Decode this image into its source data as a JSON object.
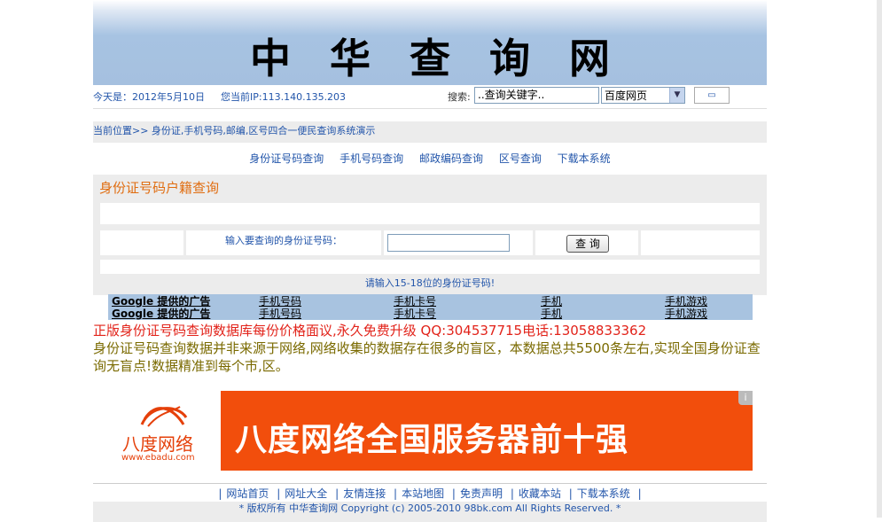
{
  "header": {
    "site_title": "中华查询网"
  },
  "infobar": {
    "date": "今天是：2012年5月10日",
    "ip": "您当前IP:113.140.135.203",
    "search_label": "搜索:",
    "search_placeholder": "..查询关键字..",
    "engine_selected": "百度网页",
    "go_label": "▭"
  },
  "breadcrumb": "当前位置>> 身份证,手机号码,邮编,区号四合一便民查询系统演示",
  "nav": [
    "身份证号码查询",
    "手机号码查询",
    "邮政编码查询",
    "区号查询",
    "下载本系统"
  ],
  "query_panel": {
    "title": "身份证号码户籍查询",
    "input_label": "输入要查询的身份证号码：",
    "button_label": "查 询",
    "hint": "请输入15-18位的身份证号码!"
  },
  "ad_links": [
    {
      "label": "Google 提供的广告",
      "links": [
        "手机号码",
        "手机卡号",
        "手机",
        "手机游戏"
      ]
    },
    {
      "label": "Google 提供的广告",
      "links": [
        "手机号码",
        "手机卡号",
        "手机",
        "手机游戏"
      ]
    }
  ],
  "promo": {
    "line1": "正版身份证号码查询数据库每份价格面议,永久免费升级 QQ:304537715电话:13058833362",
    "line2": "身份证号码查询数据并非来源于网络,网络收集的数据存在很多的盲区，本数据总共5500条左右,实现全国身份证查询无盲点!数据精准到每个市,区。"
  },
  "banner_ad": {
    "brand": "八度网络",
    "url": "www.ebadu.com",
    "slogan": "八度网络全国服务器前十强",
    "info_icon": "i"
  },
  "footer": {
    "links": [
      "网站首页",
      "网址大全",
      "友情连接",
      "本站地图",
      "免责声明",
      "收藏本站",
      "下载本系统"
    ],
    "copyright": "*  版权所有 中华查询网 Copyright (c) 2005-2010 98bk.com All Rights Reserved.  *"
  },
  "colors": {
    "link": "#2255aa",
    "accent": "#e06d10",
    "ad_bg": "#f24e0c",
    "banner": "#a5c0df"
  }
}
